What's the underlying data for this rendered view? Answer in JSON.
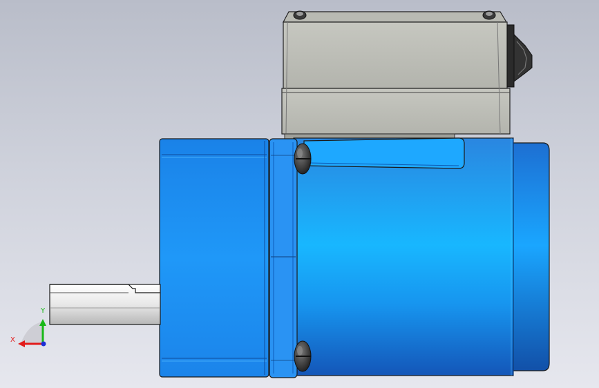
{
  "viewport": {
    "background_top": "#b9bdc9",
    "background_bottom": "#e6e7ee"
  },
  "model": {
    "parts": [
      {
        "name": "terminal-box",
        "color": "#c2c3bc"
      },
      {
        "name": "cable-gland",
        "color": "#2b2b2b"
      },
      {
        "name": "gearbox-housing",
        "color": "#1e8ef0"
      },
      {
        "name": "flange-plate",
        "color": "#2a93f3"
      },
      {
        "name": "motor-body",
        "color": "#17aaf8"
      },
      {
        "name": "motor-end-cap",
        "color": "#1282e6"
      },
      {
        "name": "output-shaft",
        "color": "#e4e4e4"
      },
      {
        "name": "mounting-screw",
        "color": "#3a3a3a"
      }
    ]
  },
  "triad": {
    "x_label": "X",
    "y_label": "Y",
    "x_color": "#e21b1b",
    "y_color": "#18b818",
    "z_color": "#1d2fd6"
  }
}
